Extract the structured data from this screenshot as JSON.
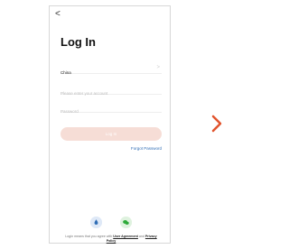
{
  "back_glyph": "<",
  "title": "Log In",
  "country": {
    "label": "China",
    "chevron": ">"
  },
  "account": {
    "placeholder": "Please enter your account"
  },
  "password": {
    "placeholder": "Password"
  },
  "login_button": {
    "label": "Log In"
  },
  "forgot_password": "Forgot Password",
  "terms": {
    "prefix": "Login means that you agree with",
    "link1": "User Agreement",
    "middle": "and",
    "link2": "Privacy Policy"
  },
  "colors": {
    "accent": "#e1542e",
    "button": "#f6ddd6",
    "link": "#2f6db5"
  },
  "icons": {
    "social_a": "water-drop-icon",
    "social_b": "wechat-icon",
    "next": "chevron-right-icon"
  }
}
